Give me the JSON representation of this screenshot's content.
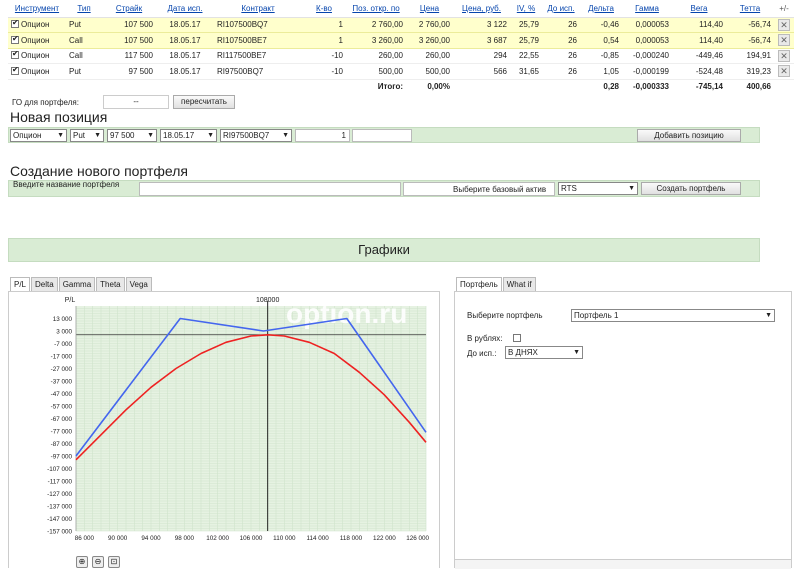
{
  "table": {
    "headers": [
      "Инструмент",
      "Тип",
      "Страйк",
      "Дата исп.",
      "Контракт",
      "К-во",
      "Поз. откр. по",
      "Цена",
      "Цена, руб.",
      "IV, %",
      "До исп.",
      "Дельта",
      "Гамма",
      "Вега",
      "Тетта",
      "+/-"
    ],
    "rows": [
      {
        "instrument": "Опцион",
        "type": "Put",
        "strike": "107 500",
        "date": "18.05.17",
        "contract": "RI107500BQ7",
        "qty": "1",
        "open": "2 760,00",
        "price": "2 760,00",
        "price_rub": "3 122",
        "iv": "25,79",
        "days": "26",
        "delta": "-0,46",
        "gamma": "0,000053",
        "vega": "114,40",
        "theta": "-56,74"
      },
      {
        "instrument": "Опцион",
        "type": "Call",
        "strike": "107 500",
        "date": "18.05.17",
        "contract": "RI107500BE7",
        "qty": "1",
        "open": "3 260,00",
        "price": "3 260,00",
        "price_rub": "3 687",
        "iv": "25,79",
        "days": "26",
        "delta": "0,54",
        "gamma": "0,000053",
        "vega": "114,40",
        "theta": "-56,74"
      },
      {
        "instrument": "Опцион",
        "type": "Call",
        "strike": "117 500",
        "date": "18.05.17",
        "contract": "RI117500BE7",
        "qty": "-10",
        "open": "260,00",
        "price": "260,00",
        "price_rub": "294",
        "iv": "22,55",
        "days": "26",
        "delta": "-0,85",
        "gamma": "-0,000240",
        "vega": "-449,46",
        "theta": "194,91"
      },
      {
        "instrument": "Опцион",
        "type": "Put",
        "strike": "97 500",
        "date": "18.05.17",
        "contract": "RI97500BQ7",
        "qty": "-10",
        "open": "500,00",
        "price": "500,00",
        "price_rub": "566",
        "iv": "31,65",
        "days": "26",
        "delta": "1,05",
        "gamma": "-0,000199",
        "vega": "-524,48",
        "theta": "319,23"
      }
    ],
    "totals": {
      "label": "Итого:",
      "price": "0,00%",
      "delta": "0,28",
      "gamma": "-0,000333",
      "vega": "-745,14",
      "theta": "400,66"
    },
    "delete_glyph": "✕"
  },
  "go": {
    "label": "ГО для портфеля:",
    "value": "--",
    "button": "пересчитать"
  },
  "new_position": {
    "title": "Новая позиция",
    "instrument": "Опцион",
    "type": "Put",
    "strike": "97 500",
    "date": "18.05.17",
    "contract": "RI97500BQ7",
    "qty": "1",
    "button": "Добавить позицию"
  },
  "create_portfolio": {
    "title": "Создание нового портфеля",
    "name_label": "Введите название портфеля",
    "asset_label": "Выберите базовый актив",
    "asset_value": "RTS",
    "button": "Создать портфель"
  },
  "graphs": {
    "title": "Графики"
  },
  "chart_tabs": [
    "P/L",
    "Delta",
    "Gamma",
    "Theta",
    "Vega"
  ],
  "right_tabs": [
    "Портфель",
    "What if"
  ],
  "portfolio_panel": {
    "select_label": "Выберите портфель",
    "select_value": "Портфель 1",
    "rub_label": "В рублях:",
    "expiry_label": "До исп.:",
    "expiry_value": "В ДНЯХ"
  },
  "colors": {
    "expiry_line": "#4466ee",
    "today_line": "#ee2222",
    "area_fill": "#e6f2e2",
    "panel_green": "#d9ecd4",
    "row_yellow": "#ffffcc"
  },
  "chart_data": {
    "type": "line",
    "ylabel": "P/L",
    "marker_label": "108000",
    "watermark": "option.ru",
    "xlim": [
      85000,
      127000
    ],
    "ylim": [
      -157000,
      23000
    ],
    "x_ticks": [
      "86 000",
      "90 000",
      "94 000",
      "98 000",
      "102 000",
      "106 000",
      "110 000",
      "114 000",
      "118 000",
      "122 000",
      "126 000"
    ],
    "x_tick_values": [
      86000,
      90000,
      94000,
      98000,
      102000,
      106000,
      110000,
      114000,
      118000,
      122000,
      126000
    ],
    "y_ticks": [
      "13 000",
      "3 000",
      "-7 000",
      "-17 000",
      "-27 000",
      "-37 000",
      "-47 000",
      "-57 000",
      "-67 000",
      "-77 000",
      "-87 000",
      "-97 000",
      "-107 000",
      "-117 000",
      "-127 000",
      "-137 000",
      "-147 000",
      "-157 000"
    ],
    "y_tick_values": [
      13000,
      3000,
      -7000,
      -17000,
      -27000,
      -37000,
      -47000,
      -57000,
      -67000,
      -77000,
      -87000,
      -97000,
      -107000,
      -117000,
      -127000,
      -137000,
      -147000,
      -157000
    ],
    "marker_x": 108000,
    "grid": true,
    "series": [
      {
        "values": [
          [
            85000,
            -97000
          ],
          [
            97500,
            13000
          ],
          [
            107500,
            3000
          ],
          [
            117500,
            13000
          ],
          [
            127000,
            -78000
          ]
        ]
      },
      {
        "values": [
          [
            85000,
            -100000
          ],
          [
            88000,
            -80000
          ],
          [
            91000,
            -60000
          ],
          [
            94000,
            -42000
          ],
          [
            97000,
            -27000
          ],
          [
            100000,
            -15000
          ],
          [
            103000,
            -6000
          ],
          [
            106000,
            -1000
          ],
          [
            108000,
            0
          ],
          [
            110000,
            -1000
          ],
          [
            113000,
            -6000
          ],
          [
            116000,
            -15000
          ],
          [
            119000,
            -30000
          ],
          [
            122000,
            -48000
          ],
          [
            125000,
            -70000
          ],
          [
            127000,
            -86000
          ]
        ]
      }
    ]
  }
}
